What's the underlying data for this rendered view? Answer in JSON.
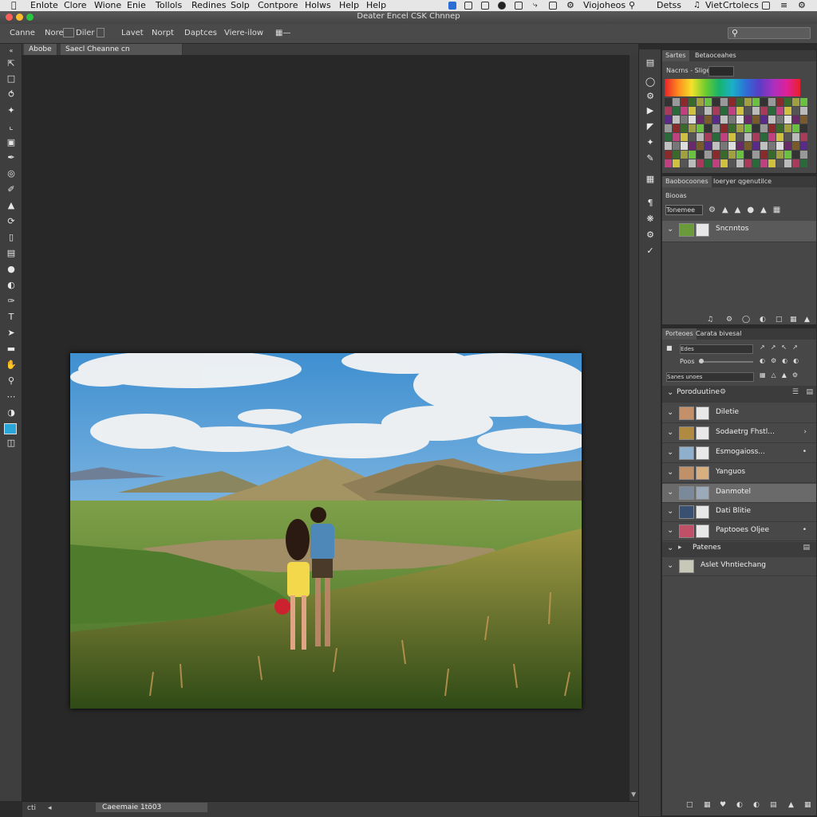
{
  "menubar": {
    "items": [
      "Enlote",
      "Clore",
      "Wione",
      "Enie",
      "Tollols",
      "Redines",
      "Solp",
      "Contpore",
      "Holws",
      "Help",
      "Help"
    ],
    "right": [
      "Viojoheos",
      "Detss",
      "Viet",
      "Crtolecs"
    ]
  },
  "titlebar": {
    "title": "Deater Encel CSK Chnnep"
  },
  "options": {
    "items": [
      "Canne",
      "Nore",
      "Diler",
      "Lavet",
      "Norpt",
      "Daptces",
      "Viere-ilow"
    ],
    "search_icon": "search-icon"
  },
  "doctabs": [
    "Abobe",
    "Saecl Cheanne cn Innnyeuthon"
  ],
  "status": {
    "zoom": "cti",
    "doc_label": "Caeemaie 1tö03"
  },
  "swatches_panel": {
    "tabs": [
      "Sartes",
      "Betaoceahes"
    ],
    "label": "Nacrns - Slige"
  },
  "layers_panel": {
    "tabs": [
      "Baobocoones",
      "Ioeryer qgenutilce"
    ],
    "mode": "Biooas",
    "blend": "Tonemee",
    "layer": "Sncnntos"
  },
  "props_panel": {
    "tabs": [
      "Porteoes",
      "Carata bivesal"
    ],
    "field1": "Edes",
    "field2": "Poos",
    "field3": "Sanes unoes",
    "group": "Poroduutine",
    "rows": [
      {
        "name": "Diletie",
        "extra": ""
      },
      {
        "name": "Sodaetrg Fhstl...",
        "extra": "›"
      },
      {
        "name": "Esmogaioss...",
        "extra": "•"
      },
      {
        "name": "Yanguos",
        "extra": ""
      },
      {
        "name": "Danmotel",
        "extra": ""
      },
      {
        "name": "Dati Blitie",
        "extra": ""
      },
      {
        "name": "Paptooes Oljee",
        "extra": "•"
      }
    ],
    "group2": "Patenes",
    "last": "Aslet Vhntiechang"
  },
  "colors": {
    "accent": "#2aa6d9",
    "panel": "#474747",
    "canvas": "#282828"
  }
}
